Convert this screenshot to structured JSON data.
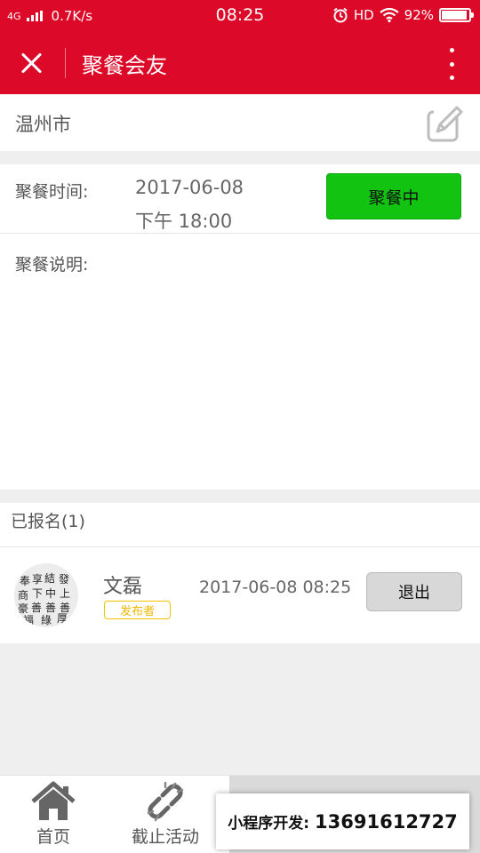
{
  "status_bar": {
    "network": "4G",
    "speed": "0.7K/s",
    "time": "08:25",
    "hd": "HD",
    "battery": "92%"
  },
  "nav": {
    "title": "聚餐会友"
  },
  "city": {
    "name": "温州市"
  },
  "meal": {
    "time_label": "聚餐时间:",
    "date": "2017-06-08",
    "time": "下午 18:00",
    "status": "聚餐中",
    "desc_label": "聚餐说明:"
  },
  "signed": {
    "title": "已报名(1)",
    "members": [
      {
        "name": "文磊",
        "badge": "发布者",
        "time": "2017-06-08 08:25",
        "action": "退出"
      }
    ]
  },
  "tabs": {
    "home": "首页",
    "stop": "截止活动"
  },
  "promo": {
    "label": "小程序开发:",
    "phone": "13691612727"
  },
  "colors": {
    "brand_red": "#dc0a28",
    "status_green": "#12c312",
    "badge_yellow": "#f0b800"
  }
}
